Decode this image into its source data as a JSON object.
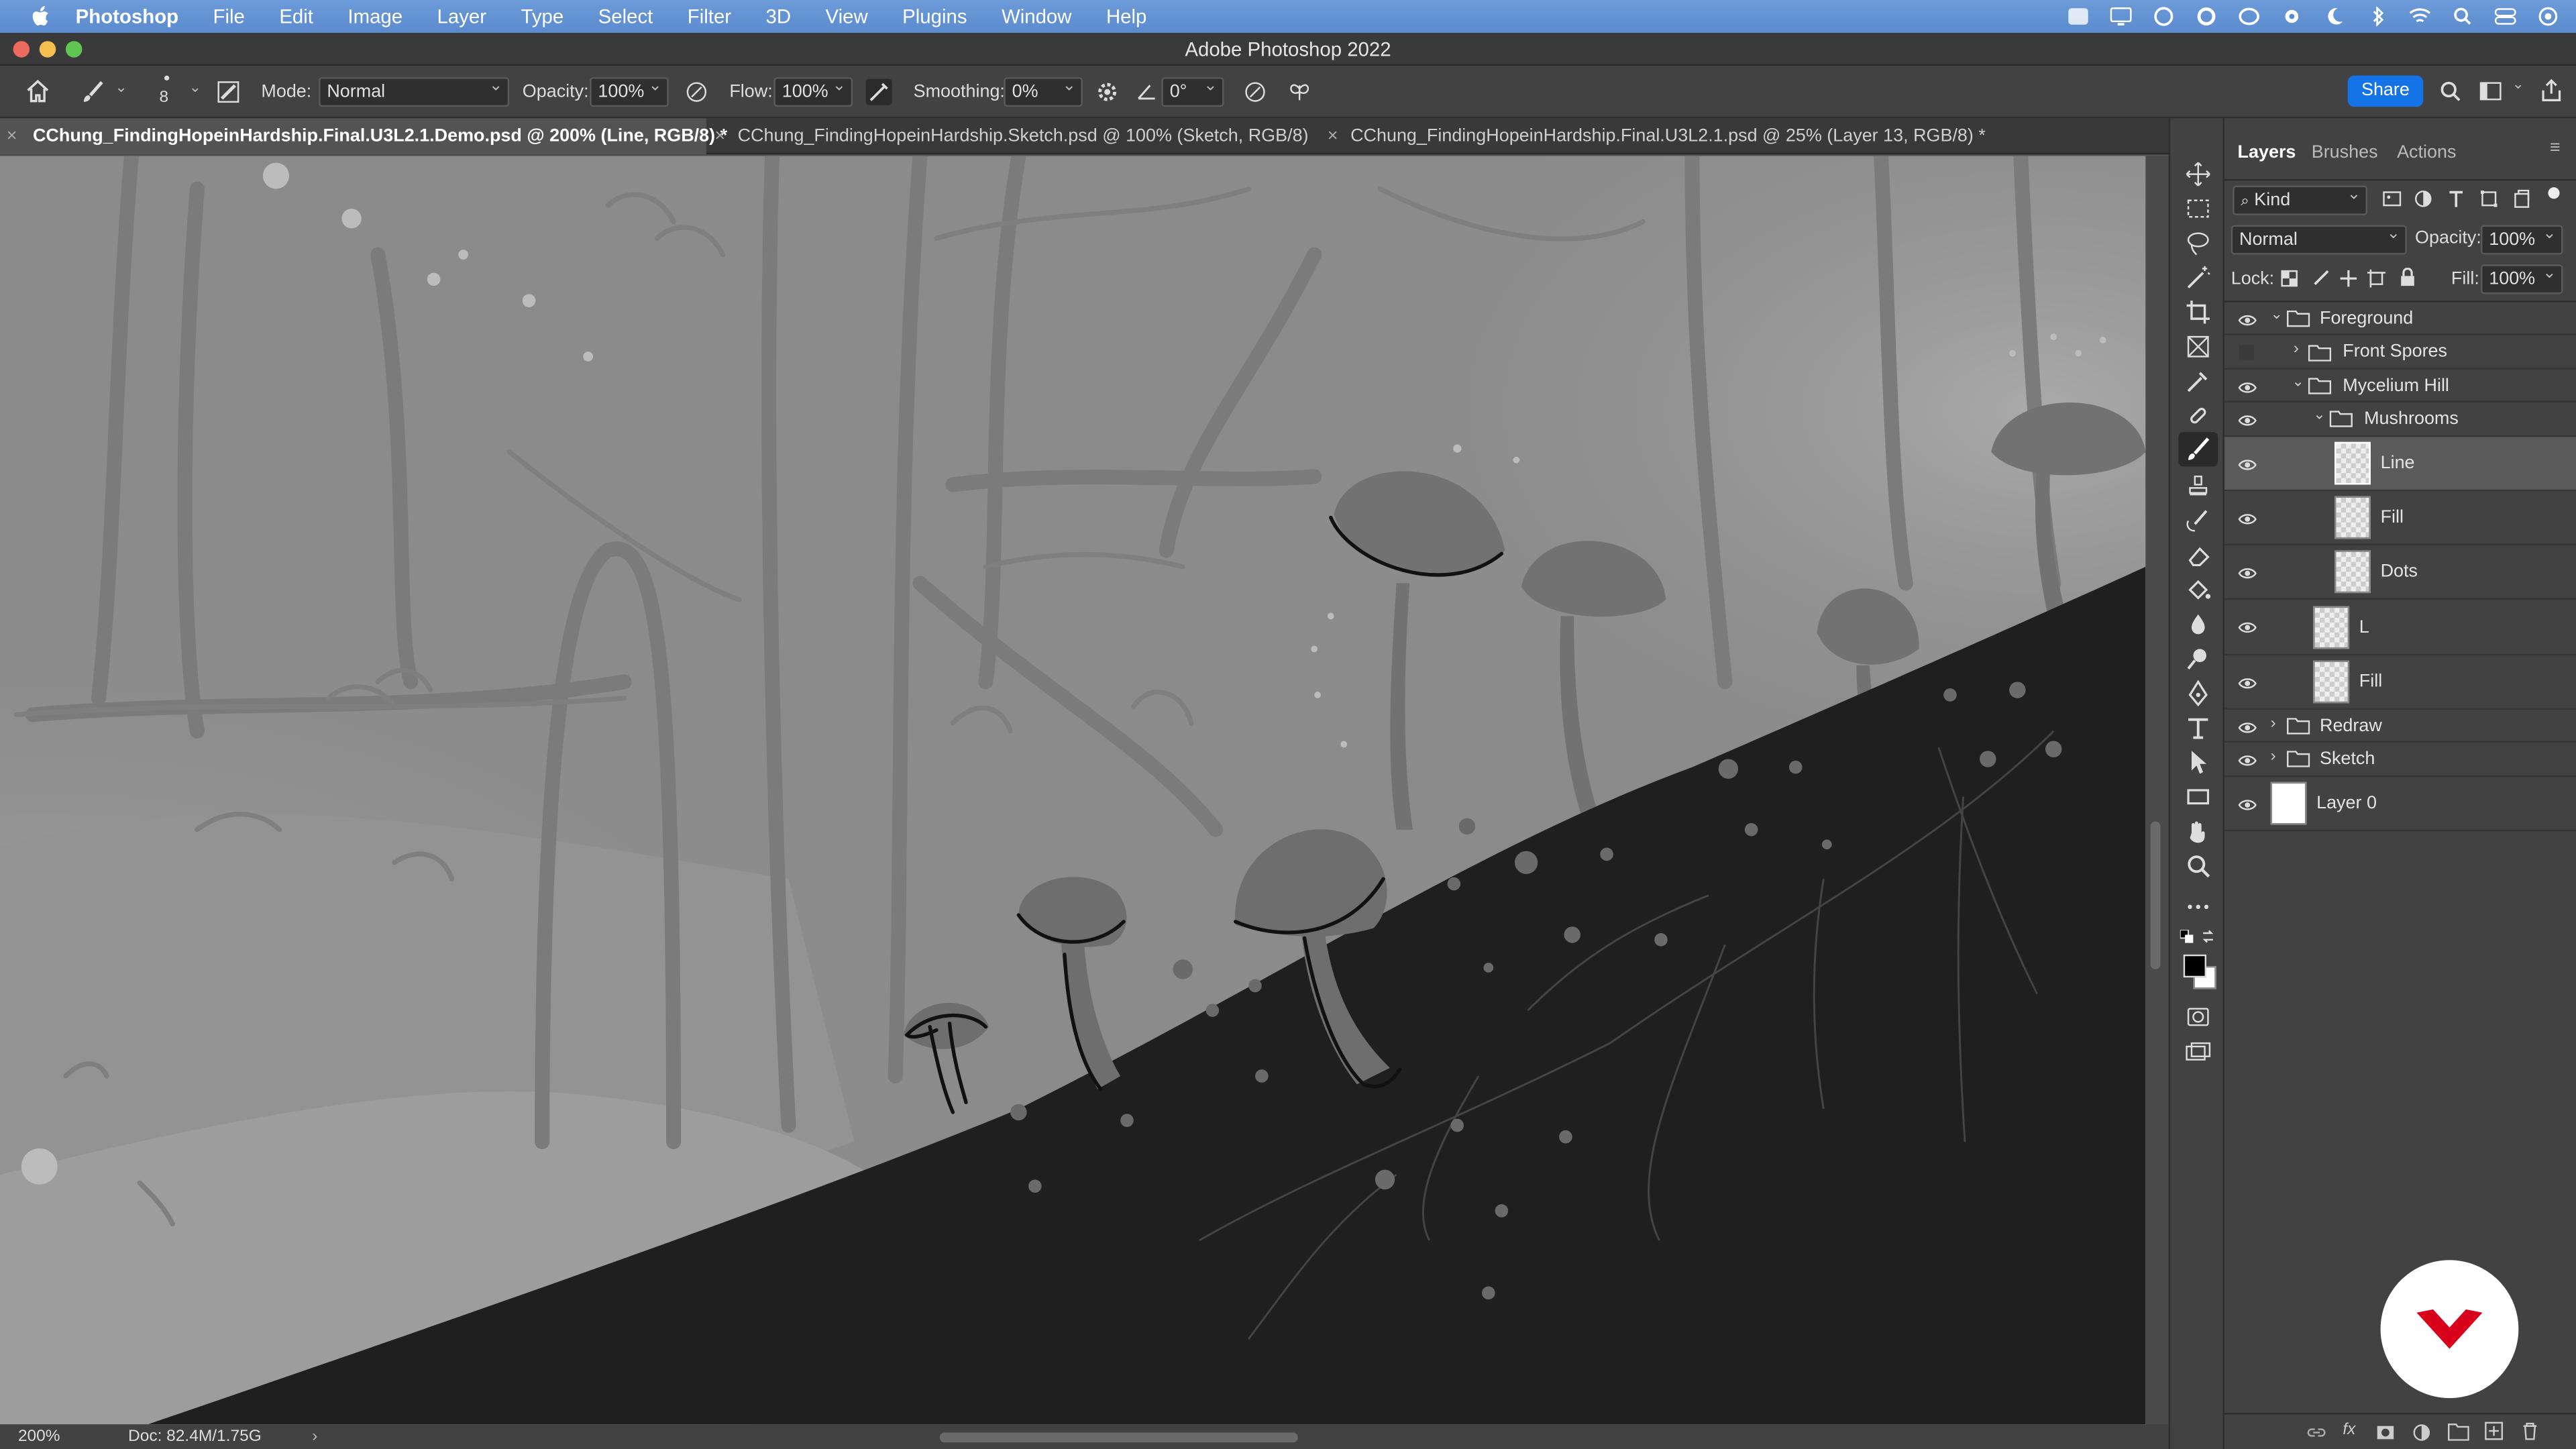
{
  "menubar": {
    "items": [
      "Photoshop",
      "File",
      "Edit",
      "Image",
      "Layer",
      "Type",
      "Select",
      "Filter",
      "3D",
      "View",
      "Plugins",
      "Window",
      "Help"
    ]
  },
  "window": {
    "title": "Adobe Photoshop 2022"
  },
  "options": {
    "brush_size": "8",
    "mode_label": "Mode:",
    "mode_value": "Normal",
    "opacity_label": "Opacity:",
    "opacity_value": "100%",
    "flow_label": "Flow:",
    "flow_value": "100%",
    "smoothing_label": "Smoothing:",
    "smoothing_value": "0%",
    "angle_value": "0°",
    "share_label": "Share"
  },
  "tabs": [
    {
      "label": "CChung_FindingHopeinHardship.Final.U3L2.1.Demo.psd @ 200% (Line, RGB/8) *",
      "active": true
    },
    {
      "label": "CChung_FindingHopeinHardship.Sketch.psd @ 100% (Sketch, RGB/8)",
      "active": false
    },
    {
      "label": "CChung_FindingHopeinHardship.Final.U3L2.1.psd @ 25% (Layer 13, RGB/8) *",
      "active": false
    }
  ],
  "status": {
    "zoom": "200%",
    "doc_info": "Doc: 82.4M/1.75G"
  },
  "panel": {
    "tabs": [
      "Layers",
      "Brushes",
      "Actions"
    ],
    "filter_kind": "Kind",
    "blend_mode": "Normal",
    "opacity_label": "Opacity:",
    "opacity_value": "100%",
    "lock_label": "Lock:",
    "fill_label": "Fill:",
    "fill_value": "100%",
    "layers": [
      {
        "name": "Foreground",
        "type": "group",
        "visible": true
      },
      {
        "name": "Front Spores",
        "type": "group",
        "visible": false
      },
      {
        "name": "Mycelium Hill",
        "type": "group",
        "visible": true
      },
      {
        "name": "Mushrooms",
        "type": "group",
        "visible": true
      },
      {
        "name": "Line",
        "type": "layer",
        "visible": true,
        "selected": true
      },
      {
        "name": "Fill",
        "type": "layer",
        "visible": true
      },
      {
        "name": "Dots",
        "type": "layer",
        "visible": true
      },
      {
        "name": "L",
        "type": "layer",
        "visible": true
      },
      {
        "name": "Fill",
        "type": "layer",
        "visible": true
      },
      {
        "name": "Redraw",
        "type": "group",
        "visible": true
      },
      {
        "name": "Sketch",
        "type": "group",
        "visible": true
      },
      {
        "name": "Layer 0",
        "type": "layer",
        "visible": true
      }
    ]
  },
  "colors": {
    "accent": "#1473e6",
    "badge_red": "#d9001b"
  }
}
